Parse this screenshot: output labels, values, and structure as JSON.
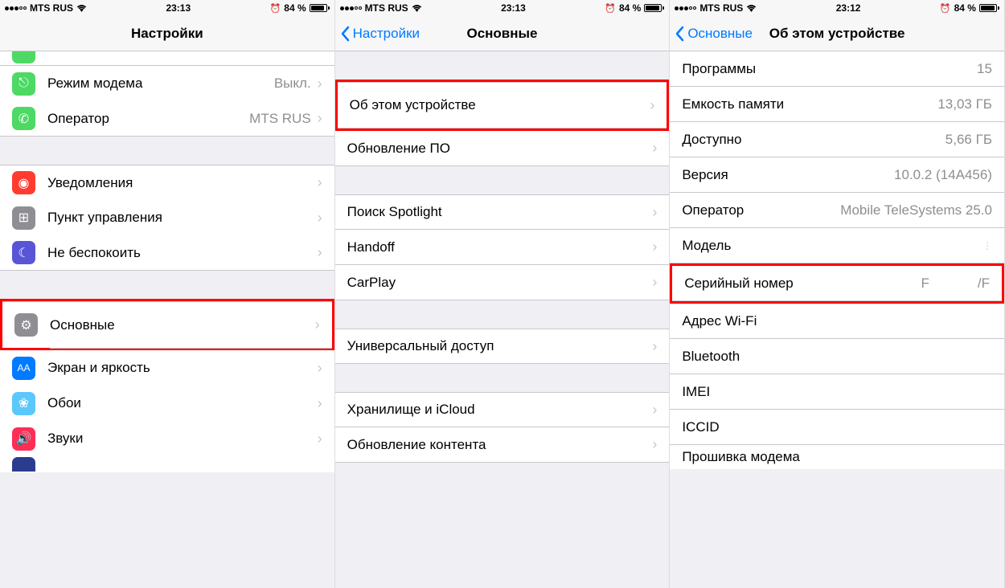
{
  "status": {
    "carrier": "MTS RUS",
    "time1": "23:13",
    "time2": "23:13",
    "time3": "23:12",
    "battery": "84 %"
  },
  "screen1": {
    "title": "Настройки",
    "rows": {
      "hotspot": {
        "label": "Режим модема",
        "value": "Выкл."
      },
      "carrier": {
        "label": "Оператор",
        "value": "MTS RUS"
      },
      "notifications": {
        "label": "Уведомления"
      },
      "control_center": {
        "label": "Пункт управления"
      },
      "dnd": {
        "label": "Не беспокоить"
      },
      "general": {
        "label": "Основные"
      },
      "display": {
        "label": "Экран и яркость"
      },
      "wallpaper": {
        "label": "Обои"
      },
      "sounds": {
        "label": "Звуки"
      }
    }
  },
  "screen2": {
    "back": "Настройки",
    "title": "Основные",
    "rows": {
      "about": {
        "label": "Об этом устройстве"
      },
      "update": {
        "label": "Обновление ПО"
      },
      "spotlight": {
        "label": "Поиск Spotlight"
      },
      "handoff": {
        "label": "Handoff"
      },
      "carplay": {
        "label": "CarPlay"
      },
      "accessibility": {
        "label": "Универсальный доступ"
      },
      "storage": {
        "label": "Хранилище и iCloud"
      },
      "refresh": {
        "label": "Обновление контента"
      }
    }
  },
  "screen3": {
    "back": "Основные",
    "title": "Об этом устройстве",
    "rows": {
      "apps": {
        "label": "Программы",
        "value": "15"
      },
      "capacity": {
        "label": "Емкость памяти",
        "value": "13,03 ГБ"
      },
      "available": {
        "label": "Доступно",
        "value": "5,66 ГБ"
      },
      "version": {
        "label": "Версия",
        "value": "10.0.2 (14A456)"
      },
      "carrier": {
        "label": "Оператор",
        "value": "Mobile TeleSystems 25.0"
      },
      "model": {
        "label": "Модель",
        "value": ""
      },
      "serial": {
        "label": "Серийный номер",
        "value_left": "F",
        "value_right": "/F"
      },
      "wifi": {
        "label": "Адрес Wi-Fi",
        "value": ""
      },
      "bluetooth": {
        "label": "Bluetooth",
        "value": ""
      },
      "imei": {
        "label": "IMEI",
        "value": ""
      },
      "iccid": {
        "label": "ICCID",
        "value": ""
      },
      "modem": {
        "label": "Прошивка модема",
        "value": ""
      }
    }
  }
}
